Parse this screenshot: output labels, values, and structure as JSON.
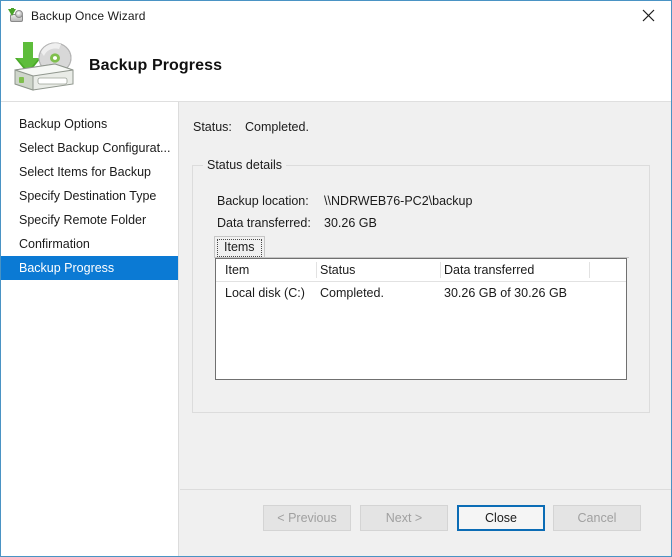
{
  "window": {
    "title": "Backup Once Wizard",
    "icon": "backup-disk-icon",
    "close_icon": "close-icon"
  },
  "banner": {
    "title": "Backup Progress",
    "icon": "backup-disk-large-icon"
  },
  "sidebar": {
    "items": [
      {
        "label": "Backup Options",
        "selected": false
      },
      {
        "label": "Select Backup Configurat...",
        "selected": false
      },
      {
        "label": "Select Items for Backup",
        "selected": false
      },
      {
        "label": "Specify Destination Type",
        "selected": false
      },
      {
        "label": "Specify Remote Folder",
        "selected": false
      },
      {
        "label": "Confirmation",
        "selected": false
      },
      {
        "label": "Backup Progress",
        "selected": true
      }
    ],
    "selected_bg": "#0b7ad4",
    "selected_fg": "#ffffff"
  },
  "main": {
    "status_label": "Status:",
    "status_value": "Completed.",
    "group_legend": "Status details",
    "details": [
      {
        "label": "Backup location:",
        "value": "\\\\NDRWEB76-PC2\\backup"
      },
      {
        "label": "Data transferred:",
        "value": "30.26 GB"
      }
    ],
    "tab_label": "Items",
    "grid": {
      "columns": [
        "Item",
        "Status",
        "Data transferred"
      ],
      "rows": [
        [
          "Local disk (C:)",
          "Completed.",
          "30.26 GB of 30.26 GB"
        ]
      ]
    }
  },
  "footer": {
    "previous_label": "< Previous",
    "next_label": "Next >",
    "close_label": "Close",
    "cancel_label": "Cancel"
  }
}
